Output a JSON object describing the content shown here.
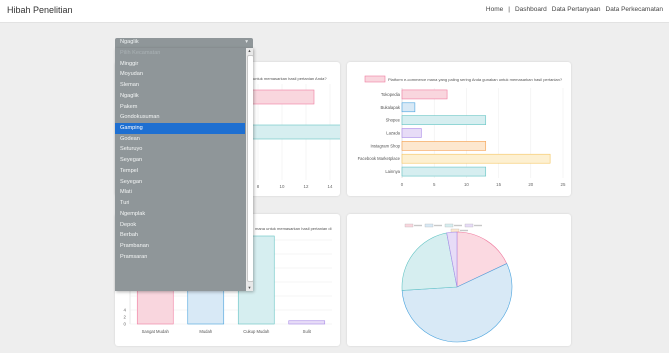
{
  "app": {
    "title": "Hibah Penelitian"
  },
  "nav": {
    "items": [
      "Home",
      "|",
      "Dashboard",
      "Data Pertanyaan",
      "Data Perkecamatan"
    ]
  },
  "dropdown": {
    "selected": "Ngaglik",
    "caret": "▾",
    "options": [
      "Pilih Kecamatan",
      "Minggir",
      "Moyudan",
      "Sleman",
      "Ngaglik",
      "Pakem",
      "Gondokusuman",
      "Gamping",
      "Godean",
      "Seturuyo",
      "Seyegan",
      "Tempel",
      "Seyegan",
      "Mlati",
      "Turi",
      "Ngemplak",
      "Depok",
      "Berbah",
      "Prambanan",
      "Pramsaran"
    ],
    "selected_index": 7
  },
  "charts": {
    "chart2": {
      "type": "bar",
      "orientation": "horizontal",
      "title": "Platform e-commerce mana yang paling sering Anda gunakan untuk memasarkan hasil pertanian?",
      "categories": [
        "Tokopedia",
        "Bukalapak",
        "Shopee",
        "Lazada",
        "Instagram Shop",
        "Facebook Marketplace",
        "Lainnya"
      ],
      "values": [
        7,
        2,
        13,
        3,
        13,
        23,
        13
      ],
      "xticks": [
        "0",
        "5",
        "10",
        "15",
        "20",
        "25"
      ],
      "xlim": [
        0,
        25
      ],
      "colors": [
        "#f9d6de",
        "#d8e9f6",
        "#d6eef0",
        "#e7dcf7",
        "#fde7cf",
        "#fdf0d1",
        "#d6eef0"
      ],
      "borders": [
        "#f07ca0",
        "#4aa3de",
        "#63c4c4",
        "#a98be8",
        "#f5a04f",
        "#f5c661",
        "#63c4c4"
      ]
    },
    "chart1": {
      "type": "bar",
      "orientation": "horizontal",
      "title_fragment": "untuk memasarkan hasil pertanian Anda?",
      "values": [
        10,
        13
      ],
      "xticks": [
        "8",
        "10",
        "12",
        "14"
      ],
      "colors": [
        "#f9d6de",
        "#d6eef0"
      ],
      "borders": [
        "#f07ca0",
        "#63c4c4"
      ]
    },
    "chart3": {
      "type": "bar",
      "title_fragment": "mana untuk memasarkan hasil pertanian di",
      "categories": [
        "Sangat Mudah",
        "Mudah",
        "Cukup Mudah",
        "Sulit"
      ],
      "values": [
        23,
        23,
        27,
        1
      ],
      "yticks": [
        "0",
        "2",
        "4"
      ],
      "colors": [
        "#f9d6de",
        "#d8e9f6",
        "#d6eef0",
        "#e7dcf7"
      ],
      "borders": [
        "#f07ca0",
        "#4aa3de",
        "#63c4c4",
        "#a98be8"
      ]
    },
    "chart4": {
      "type": "pie",
      "slices": [
        {
          "value": 18,
          "color": "#fbd9e1",
          "stroke": "#f07ca0"
        },
        {
          "value": 56,
          "color": "#d8e9f6",
          "stroke": "#4aa3de"
        },
        {
          "value": 23,
          "color": "#d6eef0",
          "stroke": "#63c4c4"
        },
        {
          "value": 3,
          "color": "#e7dcf7",
          "stroke": "#a98be8"
        }
      ],
      "legend_colors": [
        "#f9d6de",
        "#d8e9f6",
        "#d6eef0",
        "#e7dcf7",
        "#fde7cf"
      ]
    }
  },
  "chart_data": [
    {
      "type": "bar",
      "title": "Platform e-commerce mana yang paling sering Anda gunakan untuk memasarkan hasil pertanian?",
      "categories": [
        "Tokopedia",
        "Bukalapak",
        "Shopee",
        "Lazada",
        "Instagram Shop",
        "Facebook Marketplace",
        "Lainnya"
      ],
      "values": [
        7,
        2,
        13,
        3,
        13,
        23,
        13
      ],
      "xlim": [
        0,
        25
      ]
    },
    {
      "type": "bar",
      "categories": [
        "Sangat Mudah",
        "Mudah",
        "Cukup Mudah",
        "Sulit"
      ],
      "values": [
        23,
        23,
        27,
        1
      ]
    },
    {
      "type": "pie",
      "values": [
        18,
        56,
        23,
        3
      ]
    }
  ]
}
